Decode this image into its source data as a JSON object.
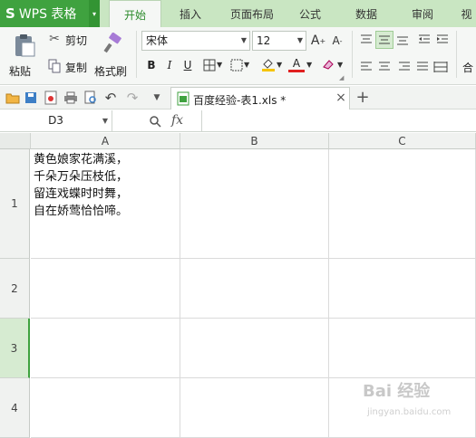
{
  "app": {
    "logo": "S",
    "name": "WPS 表格",
    "caret": "▾"
  },
  "tabs": [
    {
      "label": "开始",
      "active": true
    },
    {
      "label": "插入"
    },
    {
      "label": "页面布局"
    },
    {
      "label": "公式"
    },
    {
      "label": "数据"
    },
    {
      "label": "审阅"
    },
    {
      "label": "视"
    }
  ],
  "ribbon": {
    "paste": "粘贴",
    "cut": "剪切",
    "copy": "复制",
    "format_painter": "格式刷",
    "font_name": "宋体",
    "font_size": "12",
    "bold": "B",
    "italic": "I",
    "underline": "U",
    "font_color_letter": "A",
    "merge_partial": "合"
  },
  "quickbar": {
    "doc_tab": "百度经验-表1.xls *",
    "close": "×",
    "new_tab": "+"
  },
  "formula_bar": {
    "name_box": "D3",
    "fx": "fx",
    "value": ""
  },
  "sheet": {
    "columns": [
      "A",
      "B",
      "C"
    ],
    "rows": [
      "1",
      "2",
      "3",
      "4"
    ],
    "selected_row": "3",
    "cell_a1": "黄色娘家花满溪，\n千朵万朵压枝低，\n留连戏蝶时时舞，\n自在娇莺恰恰啼。"
  },
  "watermark": {
    "main": "Bai 经验",
    "sub": "jingyan.baidu.com"
  },
  "colors": {
    "accent": "#3fa23f",
    "titlebar": "#c9e6c2",
    "font_color": "#e02020",
    "fill_color": "#f5c400"
  }
}
